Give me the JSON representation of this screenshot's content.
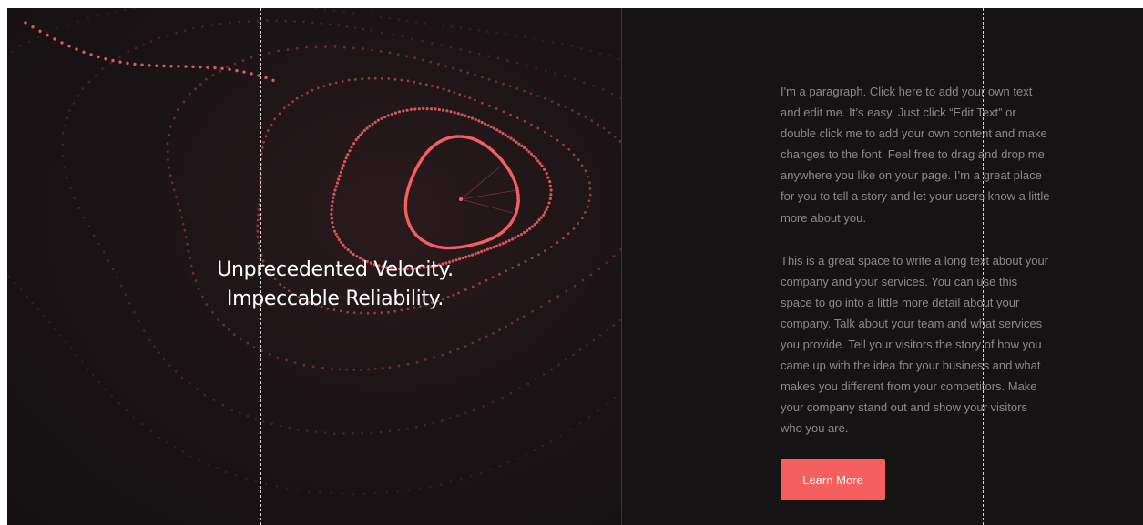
{
  "hero": {
    "headline_line1": "Unprecedented Velocity.",
    "headline_line2": "Impeccable Reliability."
  },
  "content": {
    "paragraph1": "I'm a paragraph. Click here to add your own text and edit me. It’s easy. Just click “Edit Text” or double click me to add your own content and make changes to the font. Feel free to drag and drop me anywhere you like on your page. I’m a great place for you to tell a story and let your users know a little more about you.",
    "paragraph2": "This is a great space to write a long text about your company and your services. You can use this space to go into a little more detail about your company. Talk about your team and what services you provide. Tell your visitors the story of how you came up with the idea for your business and what makes you different from your competitors. Make your company stand out and show your visitors who you are.",
    "button_label": "Learn More"
  },
  "colors": {
    "background": "#161314",
    "accent": "#f65f5f",
    "body_text": "#8d8789",
    "heading_text": "#ffffff"
  }
}
